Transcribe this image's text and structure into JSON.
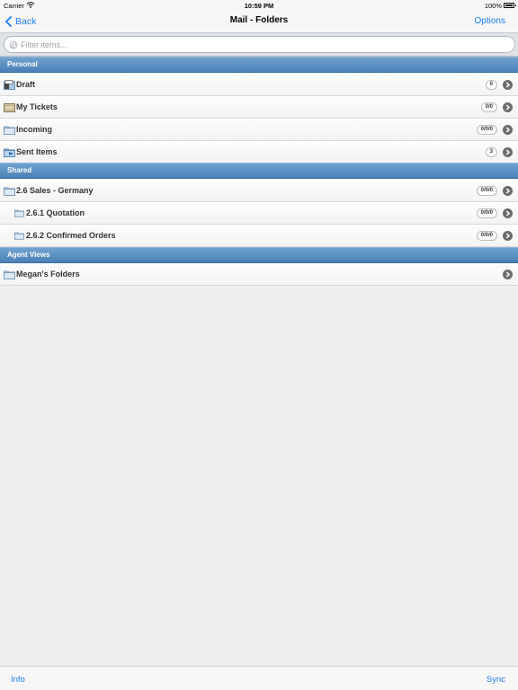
{
  "status_bar": {
    "carrier": "Carrier",
    "time": "10:59 PM",
    "battery": "100%"
  },
  "nav": {
    "back_label": "Back",
    "title": "Mail - Folders",
    "options_label": "Options"
  },
  "search": {
    "placeholder": "Filter items..."
  },
  "sections": {
    "personal": {
      "title": "Personal",
      "rows": [
        {
          "label": "Draft",
          "count": "0",
          "icon": "draft-folder-icon"
        },
        {
          "label": "My Tickets",
          "count": "0/0",
          "icon": "tickets-folder-icon"
        },
        {
          "label": "Incoming",
          "count": "0/0/0",
          "icon": "folder-icon"
        },
        {
          "label": "Sent Items",
          "count": "3",
          "icon": "sent-folder-icon"
        }
      ]
    },
    "shared": {
      "title": "Shared",
      "rows": [
        {
          "label": "2.6 Sales - Germany",
          "count": "0/0/0",
          "icon": "folder-icon"
        },
        {
          "label": "2.6.1 Quotation",
          "count": "0/0/0",
          "icon": "folder-icon"
        },
        {
          "label": "2.6.2 Confirmed Orders",
          "count": "0/0/0",
          "icon": "folder-icon"
        }
      ]
    },
    "agent_views": {
      "title": "Agent Views",
      "rows": [
        {
          "label": "Megan's Folders",
          "count": "",
          "icon": "folder-icon"
        }
      ]
    }
  },
  "toolbar": {
    "info_label": "Info",
    "sync_label": "Sync"
  },
  "colors": {
    "accent": "#1a7cf6",
    "section_header": "#4a80b7",
    "background": "#efefef"
  }
}
